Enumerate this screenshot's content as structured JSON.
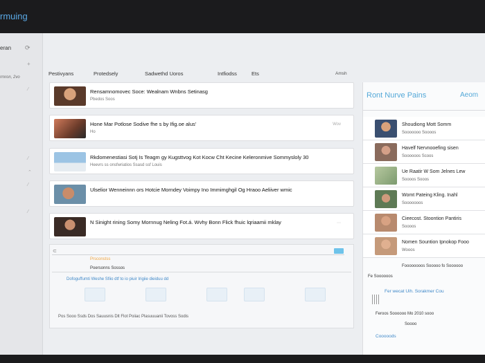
{
  "app": {
    "title": "rmuing"
  },
  "sidebar": {
    "title": "eran",
    "date": "rmron, 2vo"
  },
  "tabs": [
    {
      "label": "Pestivyans"
    },
    {
      "label": "Protedsely"
    },
    {
      "label": "Sadwethd Uoros"
    },
    {
      "label": "Intfiodss"
    },
    {
      "label": "Ets"
    }
  ],
  "search": {
    "label": "Amsh"
  },
  "feed": [
    {
      "title": "Rensamnomovec Soce:  Wealnam Wnbns Setinasg",
      "sub": "Pbedos Soos",
      "badge": ""
    },
    {
      "title": "Hone Mar Potlose Sodive fhe s by Ifig.oe alus'",
      "sub": "Ho",
      "badge": "Wov"
    },
    {
      "title": "Rkdomenestiasi Sotj Is Teagm gy  Kugsttvog Kot Kocw Cht Kecine Keleronmive Sommysloly  30",
      "sub": "Heevrs ss onsfwriatios Ssasd ssf Louis",
      "badge": ""
    },
    {
      "title": "Ulselior Wenneinnn ors Hotcie Morndey Voimpy Ino Immimghgil Og Hraoo Aeliiver wmic",
      "sub": "",
      "badge": ""
    },
    {
      "title": "N Sinight rining Somy Mornnug Neling Fot.á.  Wvhy Bonn Flick fhuic lqriaamii mklay",
      "sub": "",
      "badge": ""
    }
  ],
  "widget": {
    "orange": "Prsconstss",
    "section": "Poersonns Sossos",
    "blue": "Dofoguffumti Weshe Sfiio dtf to io piuir Irigiie dieiduu dd",
    "footer": "Pos Sooo Ssds Dos Sauusnis Dlt Flot Poiiac Plasuuuanii Tovoss Sodis"
  },
  "right_panel": {
    "title": "Ront Nurve Pains",
    "account": "Aeom",
    "items": [
      {
        "title": "Shoudiong Mott Somm",
        "sub": "Sooooooo Soooos"
      },
      {
        "title": "Havelf Nervnooefing sisen",
        "sub": "Soooooos Scoos"
      },
      {
        "title": "Ue Raatir W Som Jelnes Lew",
        "sub": "Soooos Sooos"
      },
      {
        "title": "Womt Pateing Kling. Inahl",
        "sub": "Sooooooos"
      },
      {
        "title": "Cieecost. Stoontion Pantiris",
        "sub": "Soooos"
      },
      {
        "title": "Nomen Sountion Ipnokop Fooo",
        "sub": "Wooos"
      }
    ],
    "small_list": {
      "row1": "Foooooooos Sooooo fo Soooooo",
      "row2": "Fe Soooooos",
      "heading": "Fer wecat Uih. Sorakmer Cou",
      "row3": "Feroos Soooooo Mo 2010 sooo",
      "row4": "Soooo",
      "footer": "Cooooods"
    }
  }
}
